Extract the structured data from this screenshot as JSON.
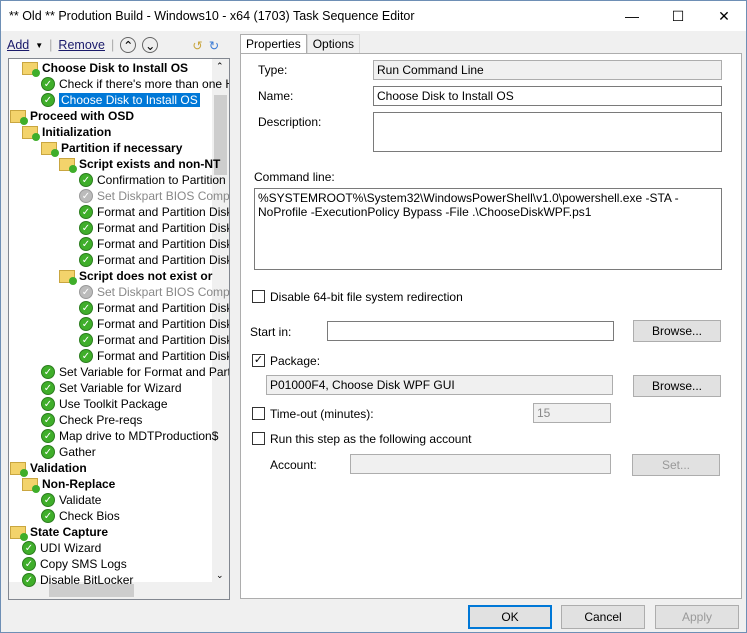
{
  "window": {
    "title": "** Old ** Prodution Build - Windows10 - x64 (1703) Task Sequence Editor"
  },
  "toolbar": {
    "add": "Add",
    "remove": "Remove"
  },
  "tree": [
    {
      "label": "Choose Disk to Install OS",
      "level": 1,
      "type": "group",
      "bold": true
    },
    {
      "label": "Check if there's more than one H",
      "level": 2,
      "type": "step"
    },
    {
      "label": "Choose Disk to Install OS",
      "level": 2,
      "type": "step",
      "selected": true
    },
    {
      "label": "Proceed with OSD",
      "level": 0,
      "type": "group",
      "bold": true
    },
    {
      "label": "Initialization",
      "level": 1,
      "type": "group",
      "bold": true
    },
    {
      "label": "Partition if necessary",
      "level": 2,
      "type": "group",
      "bold": true
    },
    {
      "label": "Script exists and non-NT",
      "level": 3,
      "type": "group",
      "bold": true
    },
    {
      "label": "Confirmation to Partition",
      "level": 4,
      "type": "step"
    },
    {
      "label": "Set Diskpart BIOS Comp",
      "level": 4,
      "type": "step",
      "disabled": true
    },
    {
      "label": "Format and Partition Disk",
      "level": 4,
      "type": "step"
    },
    {
      "label": "Format and Partition Disk",
      "level": 4,
      "type": "step"
    },
    {
      "label": "Format and Partition Disk",
      "level": 4,
      "type": "step"
    },
    {
      "label": "Format and Partition Disk",
      "level": 4,
      "type": "step"
    },
    {
      "label": "Script does not exist or",
      "level": 3,
      "type": "group",
      "bold": true
    },
    {
      "label": "Set Diskpart BIOS Comp",
      "level": 4,
      "type": "step",
      "disabled": true
    },
    {
      "label": "Format and Partition Disk",
      "level": 4,
      "type": "step"
    },
    {
      "label": "Format and Partition Disk",
      "level": 4,
      "type": "step"
    },
    {
      "label": "Format and Partition Disk",
      "level": 4,
      "type": "step"
    },
    {
      "label": "Format and Partition Disk",
      "level": 4,
      "type": "step"
    },
    {
      "label": "Set Variable for Format and Partit",
      "level": 2,
      "type": "step"
    },
    {
      "label": "Set Variable for Wizard",
      "level": 2,
      "type": "step"
    },
    {
      "label": "Use Toolkit Package",
      "level": 2,
      "type": "step"
    },
    {
      "label": "Check Pre-reqs",
      "level": 2,
      "type": "step"
    },
    {
      "label": "Map drive to MDTProduction$",
      "level": 2,
      "type": "step"
    },
    {
      "label": "Gather",
      "level": 2,
      "type": "step"
    },
    {
      "label": "Validation",
      "level": 0,
      "type": "group",
      "bold": true
    },
    {
      "label": "Non-Replace",
      "level": 1,
      "type": "group",
      "bold": true
    },
    {
      "label": "Validate",
      "level": 2,
      "type": "step"
    },
    {
      "label": "Check Bios",
      "level": 2,
      "type": "step"
    },
    {
      "label": "State Capture",
      "level": 0,
      "type": "group",
      "bold": true
    },
    {
      "label": "UDI Wizard",
      "level": 1,
      "type": "step"
    },
    {
      "label": "Copy SMS Logs",
      "level": 1,
      "type": "step"
    },
    {
      "label": "Disable BitLocker",
      "level": 1,
      "type": "step"
    }
  ],
  "tabs": [
    "Properties",
    "Options"
  ],
  "props": {
    "type_label": "Type:",
    "type_value": "Run Command Line",
    "name_label": "Name:",
    "name_value": "Choose Disk to Install OS",
    "desc_label": "Description:",
    "desc_value": "",
    "cmd_label": "Command line:",
    "cmd_value": "%SYSTEMROOT%\\System32\\WindowsPowerShell\\v1.0\\powershell.exe -STA -NoProfile -ExecutionPolicy Bypass -File .\\ChooseDiskWPF.ps1",
    "disable64": "Disable 64-bit file system redirection",
    "disable64_checked": false,
    "startin_label": "Start in:",
    "startin_value": "",
    "browse": "Browse...",
    "package_label": "Package:",
    "package_checked": true,
    "package_value": "P01000F4, Choose Disk WPF GUI",
    "timeout_label": "Time-out (minutes):",
    "timeout_checked": false,
    "timeout_value": "15",
    "runas_label": "Run this step as the following account",
    "runas_checked": false,
    "account_label": "Account:",
    "account_value": "",
    "set": "Set..."
  },
  "buttons": {
    "ok": "OK",
    "cancel": "Cancel",
    "apply": "Apply"
  }
}
